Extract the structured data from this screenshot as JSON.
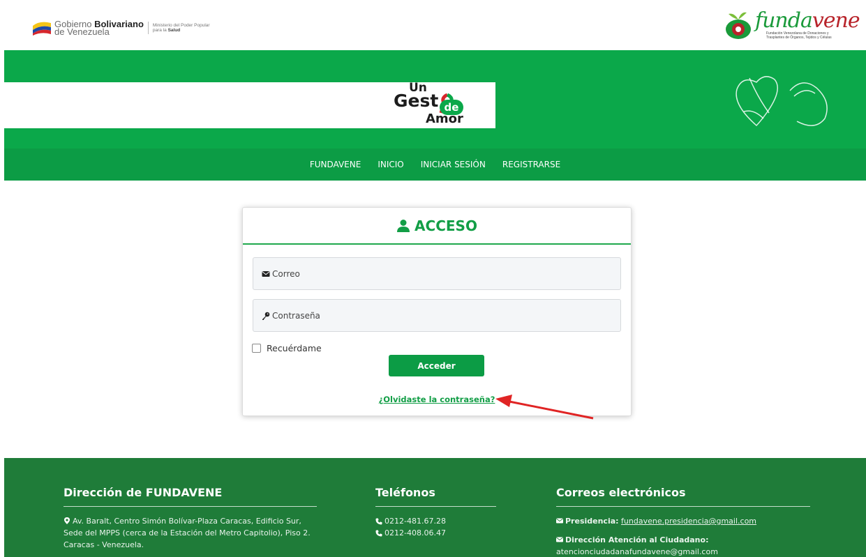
{
  "gov_header": {
    "line1_prefix": "Gobierno ",
    "line1_bold": "Bolivariano",
    "line2": "de Venezuela",
    "ministry_line1": "Ministerio del Poder Popular",
    "ministry_line2_prefix": "para la ",
    "ministry_line2_bold": "Salud"
  },
  "fundavene_logo": {
    "word_green": "funda",
    "word_red": "vene",
    "subtitle": "Fundación Venezolana de Donaciones y Trasplantes de Órganos, Tejidos y Células"
  },
  "campaign_logo": {
    "un": "Un",
    "gest": "Gest",
    "de": "de",
    "amor": "Amor"
  },
  "nav": {
    "items": [
      "FUNDAVENE",
      "INICIO",
      "INICIAR SESIÓN",
      "REGISTRARSE"
    ]
  },
  "login": {
    "title": "ACCESO",
    "email_placeholder": "Correo",
    "password_placeholder": "Contraseña",
    "remember_label": "Recuérdame",
    "submit_label": "Acceder",
    "forgot_label": "¿Olvidaste la contraseña?"
  },
  "footer": {
    "address": {
      "title": "Dirección de FUNDAVENE",
      "text": "Av. Baralt, Centro Simón Bolívar-Plaza Caracas, Edificio Sur, Sede del MPPS (cerca de la Estación del Metro Capitolio), Piso 2. Caracas - Venezuela."
    },
    "phones": {
      "title": "Teléfonos",
      "items": [
        "0212-481.67.28",
        "0212-408.06.47"
      ]
    },
    "emails": {
      "title": "Correos electrónicos",
      "presidencia_label": "Presidencia:",
      "presidencia_email": "fundavene.presidencia@gmail.com",
      "atencion_label": "Dirección Atención al Ciudadano:",
      "atencion_email": "atencionciudadanafundavene@gmail.com"
    }
  },
  "colors": {
    "brand_green": "#0ba84a",
    "nav_green": "#0c9c45",
    "footer_green": "#1f7c39",
    "annotation_arrow": "#e02424"
  }
}
